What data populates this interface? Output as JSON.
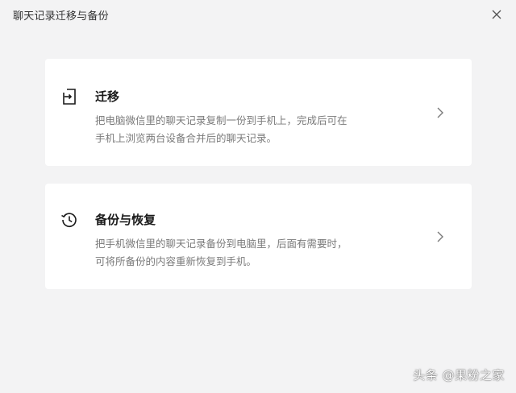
{
  "window": {
    "title": "聊天记录迁移与备份",
    "close_icon": "close-icon"
  },
  "cards": [
    {
      "icon": "migrate-icon",
      "title": "迁移",
      "desc_lines": [
        "把电脑微信里的聊天记录复制一份到手机上，完成后可在",
        "手机上浏览两台设备合并后的聊天记录。"
      ]
    },
    {
      "icon": "history-icon",
      "title": "备份与恢复",
      "desc_lines": [
        "把手机微信里的聊天记录备份到电脑里，后面有需要时，",
        "可将所备份的内容重新恢复到手机。"
      ]
    }
  ],
  "watermark": "头条 @果粉之家",
  "colors": {
    "background": "#f3f3f4",
    "card": "#ffffff",
    "text_primary": "#1a1a1a",
    "text_secondary": "#7a7a7a"
  }
}
